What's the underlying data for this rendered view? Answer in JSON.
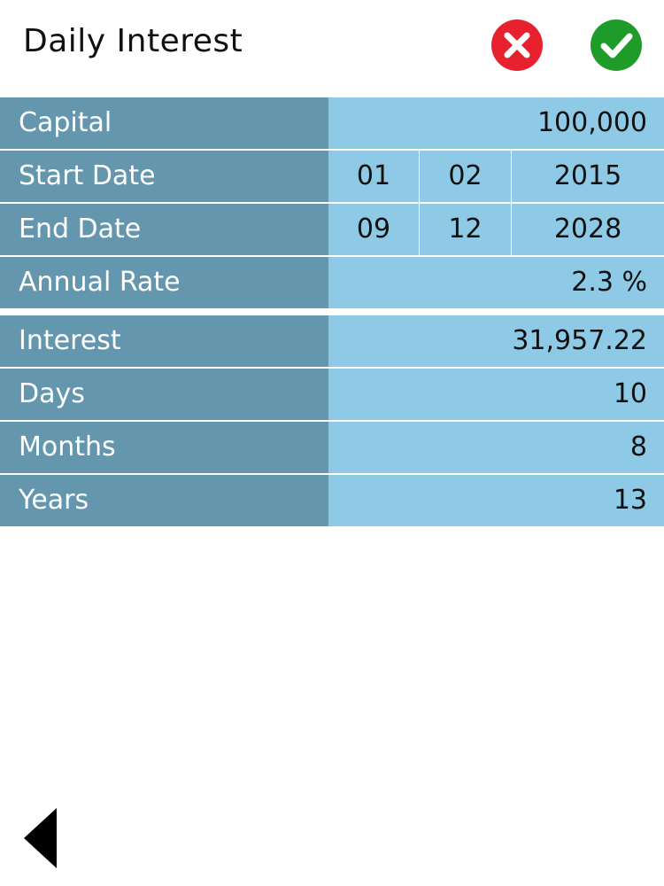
{
  "header": {
    "title": "Daily Interest",
    "cancel_icon": "close-circle-icon",
    "confirm_icon": "check-circle-icon",
    "cancel_color": "#e8212e",
    "confirm_color": "#1f9b2a"
  },
  "inputs": {
    "capital": {
      "label": "Capital",
      "value": "100,000"
    },
    "start_date": {
      "label": "Start Date",
      "day": "01",
      "month": "02",
      "year": "2015"
    },
    "end_date": {
      "label": "End Date",
      "day": "09",
      "month": "12",
      "year": "2028"
    },
    "annual_rate": {
      "label": "Annual Rate",
      "value": "2.3 %"
    }
  },
  "results": {
    "interest": {
      "label": "Interest",
      "value": "31,957.22"
    },
    "days": {
      "label": "Days",
      "value": "10"
    },
    "months": {
      "label": "Months",
      "value": "8"
    },
    "years": {
      "label": "Years",
      "value": "13"
    }
  },
  "footer": {
    "back_icon": "back-arrow-icon"
  },
  "colors": {
    "label_bg": "#6497ad",
    "value_bg": "#8ecae6"
  }
}
